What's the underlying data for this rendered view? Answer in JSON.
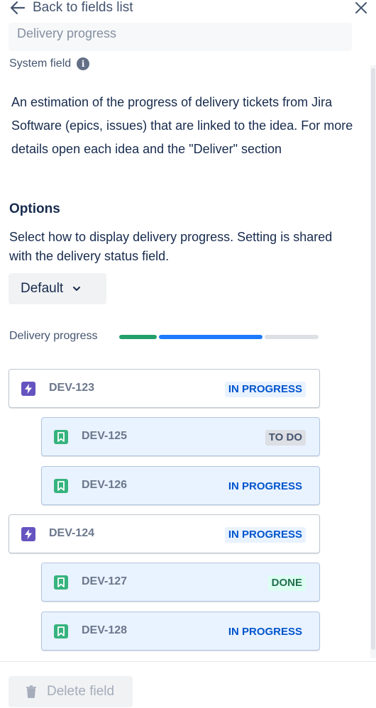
{
  "header": {
    "back_label": "Back to fields list"
  },
  "field": {
    "name": "Delivery progress",
    "system_label": "System field",
    "description": "An estimation of the progress of delivery tickets from Jira Software (epics, issues) that are linked to the idea. For more details open each idea and the \"Deliver\" section"
  },
  "options": {
    "heading": "Options",
    "description": "Select how to display delivery progress. Setting is shared with the delivery status field.",
    "display_value": "Default"
  },
  "progress": {
    "label": "Delivery progress",
    "done_fraction": 0.2,
    "in_progress_fraction": 0.53,
    "todo_fraction": 0.27,
    "colors": {
      "done": "#22a06b",
      "in_progress": "#1d7afc",
      "todo": "#dcdfe4"
    }
  },
  "tickets": [
    {
      "key": "DEV-123",
      "type": "epic",
      "status": "IN PROGRESS"
    },
    {
      "key": "DEV-125",
      "type": "story",
      "status": "TO DO"
    },
    {
      "key": "DEV-126",
      "type": "story",
      "status": "IN PROGRESS"
    },
    {
      "key": "DEV-124",
      "type": "epic",
      "status": "IN PROGRESS"
    },
    {
      "key": "DEV-127",
      "type": "story",
      "status": "DONE"
    },
    {
      "key": "DEV-128",
      "type": "story",
      "status": "IN PROGRESS"
    }
  ],
  "footer": {
    "delete_label": "Delete field"
  },
  "icons": {
    "back": "arrow-left-icon",
    "close": "close-icon",
    "info": "info-icon",
    "dropdown": "chevron-down-icon",
    "epic": "lightning-icon",
    "story": "bookmark-icon",
    "delete": "trash-icon"
  }
}
